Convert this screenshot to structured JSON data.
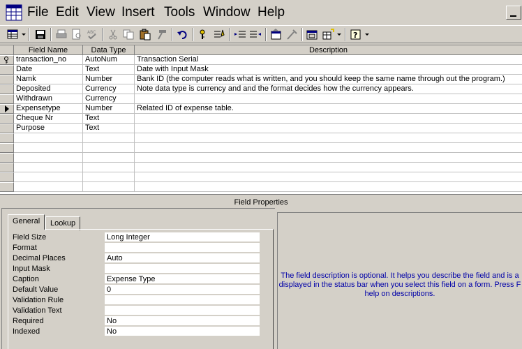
{
  "menu": {
    "file": "File",
    "edit": "Edit",
    "view": "View",
    "insert": "Insert",
    "tools": "Tools",
    "window": "Window",
    "help": "Help"
  },
  "grid": {
    "headers": {
      "field_name": "Field Name",
      "data_type": "Data Type",
      "description": "Description"
    },
    "rows": [
      {
        "name": "transaction_no",
        "type": "AutoNum",
        "desc": "Transaction Serial"
      },
      {
        "name": "Date",
        "type": "Text",
        "desc": "Date with Input Mask"
      },
      {
        "name": "Namk",
        "type": "Number",
        "desc": "Bank ID (the computer reads what is written, and you should keep the same name through out the program.)"
      },
      {
        "name": "Deposited",
        "type": "Currency",
        "desc": "Note data type is currency and and the format decides how the currency appears."
      },
      {
        "name": "Withdrawn",
        "type": "Currency",
        "desc": ""
      },
      {
        "name": "Expensetype",
        "type": "Number",
        "desc": "Related ID of expense table."
      },
      {
        "name": "Cheque Nr",
        "type": "Text",
        "desc": ""
      },
      {
        "name": "Purpose",
        "type": "Text",
        "desc": ""
      }
    ],
    "empty_rows": 6
  },
  "field_properties": {
    "title": "Field Properties",
    "tabs": {
      "general": "General",
      "lookup": "Lookup"
    },
    "properties": [
      {
        "label": "Field Size",
        "value": "Long Integer"
      },
      {
        "label": "Format",
        "value": ""
      },
      {
        "label": "Decimal Places",
        "value": "Auto"
      },
      {
        "label": "Input Mask",
        "value": ""
      },
      {
        "label": "Caption",
        "value": "Expense Type"
      },
      {
        "label": "Default Value",
        "value": "0"
      },
      {
        "label": "Validation Rule",
        "value": ""
      },
      {
        "label": "Validation Text",
        "value": ""
      },
      {
        "label": "Required",
        "value": "No"
      },
      {
        "label": "Indexed",
        "value": "No"
      }
    ],
    "help_text": "The field description is optional.  It helps you describe the field and is a\ndisplayed in the status bar when you select this field on a form.  Press F\nhelp on descriptions."
  },
  "colors": {
    "chrome": "#d4d0c8",
    "help_text": "#0000a8"
  },
  "icons": [
    "table-view-icon",
    "save-icon",
    "print-icon",
    "print-preview-icon",
    "spelling-icon",
    "cut-icon",
    "copy-icon",
    "paste-icon",
    "format-painter-icon",
    "undo-icon",
    "primary-key-icon",
    "indexes-icon",
    "insert-rows-icon",
    "delete-rows-icon",
    "properties-icon",
    "build-icon",
    "database-window-icon",
    "new-object-icon",
    "help-icon",
    "row-selector-arrow-icon"
  ]
}
